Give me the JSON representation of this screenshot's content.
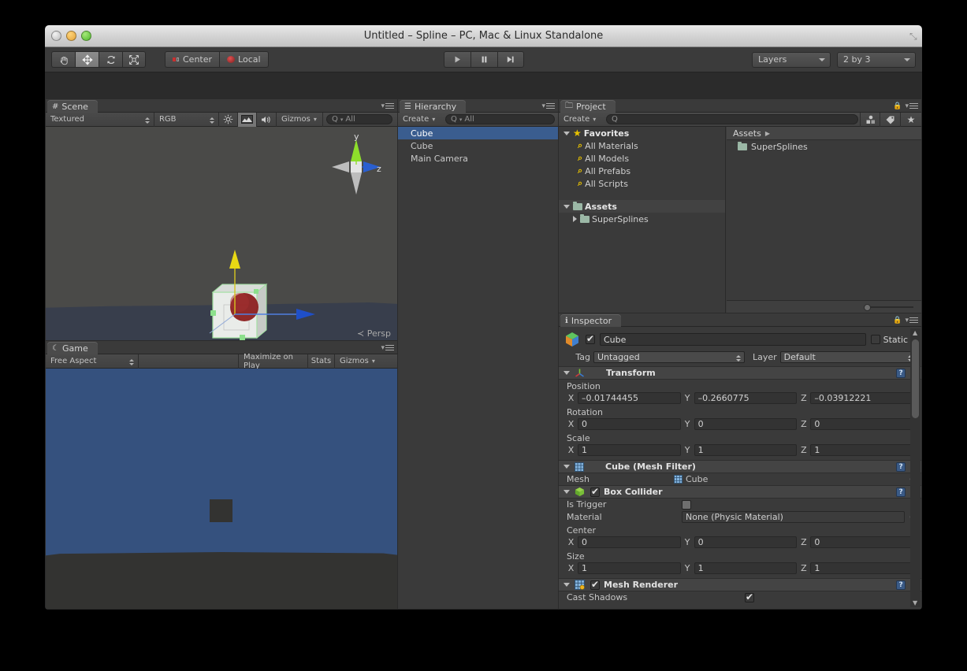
{
  "window": {
    "title": "Untitled – Spline – PC, Mac & Linux Standalone",
    "traffic": {
      "close": "close-button",
      "minimize": "minimize-button",
      "zoom": "zoom-button"
    }
  },
  "toolbar": {
    "transform_tools": [
      {
        "name": "hand-tool",
        "glyph": "✋"
      },
      {
        "name": "move-tool",
        "glyph": "✥"
      },
      {
        "name": "rotate-tool",
        "glyph": "⟳"
      },
      {
        "name": "scale-tool",
        "glyph": "⤢"
      }
    ],
    "pivot_mode": "Center",
    "pivot_rotation": "Local",
    "play": "▶",
    "pause": "❚❚",
    "step": "▶❙",
    "layers": "Layers",
    "layout": "2 by 3"
  },
  "scene_panel": {
    "tab": "Scene",
    "draw_mode": "Textured",
    "render_mode": "RGB",
    "lighting_icon": "sun-icon",
    "fx_icon": "effects-icon",
    "audio_icon": "audio-icon",
    "gizmos": "Gizmos",
    "search_placeholder": "All",
    "gizmo_axes": {
      "y": "y",
      "z": "z"
    },
    "projection": "Persp"
  },
  "game_panel": {
    "tab": "Game",
    "aspect": "Free Aspect",
    "maximize": "Maximize on Play",
    "stats": "Stats",
    "gizmos": "Gizmos"
  },
  "hierarchy_panel": {
    "tab": "Hierarchy",
    "create": "Create",
    "search_placeholder": "All",
    "items": [
      {
        "label": "Cube",
        "selected": true
      },
      {
        "label": "Cube",
        "selected": false
      },
      {
        "label": "Main Camera",
        "selected": false
      }
    ]
  },
  "project_panel": {
    "tab": "Project",
    "create": "Create",
    "search_placeholder": "",
    "favorites_label": "Favorites",
    "favorites": [
      "All Materials",
      "All Models",
      "All Prefabs",
      "All Scripts"
    ],
    "assets_label": "Assets",
    "assets_tree": [
      "SuperSplines"
    ],
    "breadcrumb": "Assets",
    "asset_items": [
      "SuperSplines"
    ]
  },
  "inspector": {
    "tab": "Inspector",
    "object_name": "Cube",
    "object_enabled": true,
    "static_label": "Static",
    "static_checked": false,
    "tag_label": "Tag",
    "tag_value": "Untagged",
    "layer_label": "Layer",
    "layer_value": "Default",
    "components": [
      {
        "title": "Transform",
        "icon": "transform-icon",
        "groups": [
          {
            "label": "Position",
            "x": "–0.01744455",
            "y": "–0.2660775",
            "z": "–0.03912221"
          },
          {
            "label": "Rotation",
            "x": "0",
            "y": "0",
            "z": "0"
          },
          {
            "label": "Scale",
            "x": "1",
            "y": "1",
            "z": "1"
          }
        ]
      },
      {
        "title": "Cube (Mesh Filter)",
        "icon": "mesh-filter-icon",
        "mesh_label": "Mesh",
        "mesh_value": "Cube"
      },
      {
        "title": "Box Collider",
        "icon": "box-collider-icon",
        "enabled": true,
        "is_trigger_label": "Is Trigger",
        "is_trigger_checked": false,
        "material_label": "Material",
        "material_value": "None (Physic Material)",
        "groups": [
          {
            "label": "Center",
            "x": "0",
            "y": "0",
            "z": "0"
          },
          {
            "label": "Size",
            "x": "1",
            "y": "1",
            "z": "1"
          }
        ]
      },
      {
        "title": "Mesh Renderer",
        "icon": "mesh-renderer-icon",
        "enabled": true,
        "cast_shadows_label": "Cast Shadows",
        "cast_shadows_checked": true
      }
    ],
    "axis_labels": {
      "x": "X",
      "y": "Y",
      "z": "Z"
    }
  },
  "colors": {
    "panel_bg": "#3a3a3a",
    "selection_blue": "#3a5d8f",
    "scene_sky": "#4a4a48",
    "scene_ground": "#383e4c",
    "game_sky": "#35517e",
    "game_floor": "#333331",
    "gizmo_y": "#cfd11a",
    "gizmo_z": "#2a60d8",
    "favorite_star": "#e8c200"
  }
}
